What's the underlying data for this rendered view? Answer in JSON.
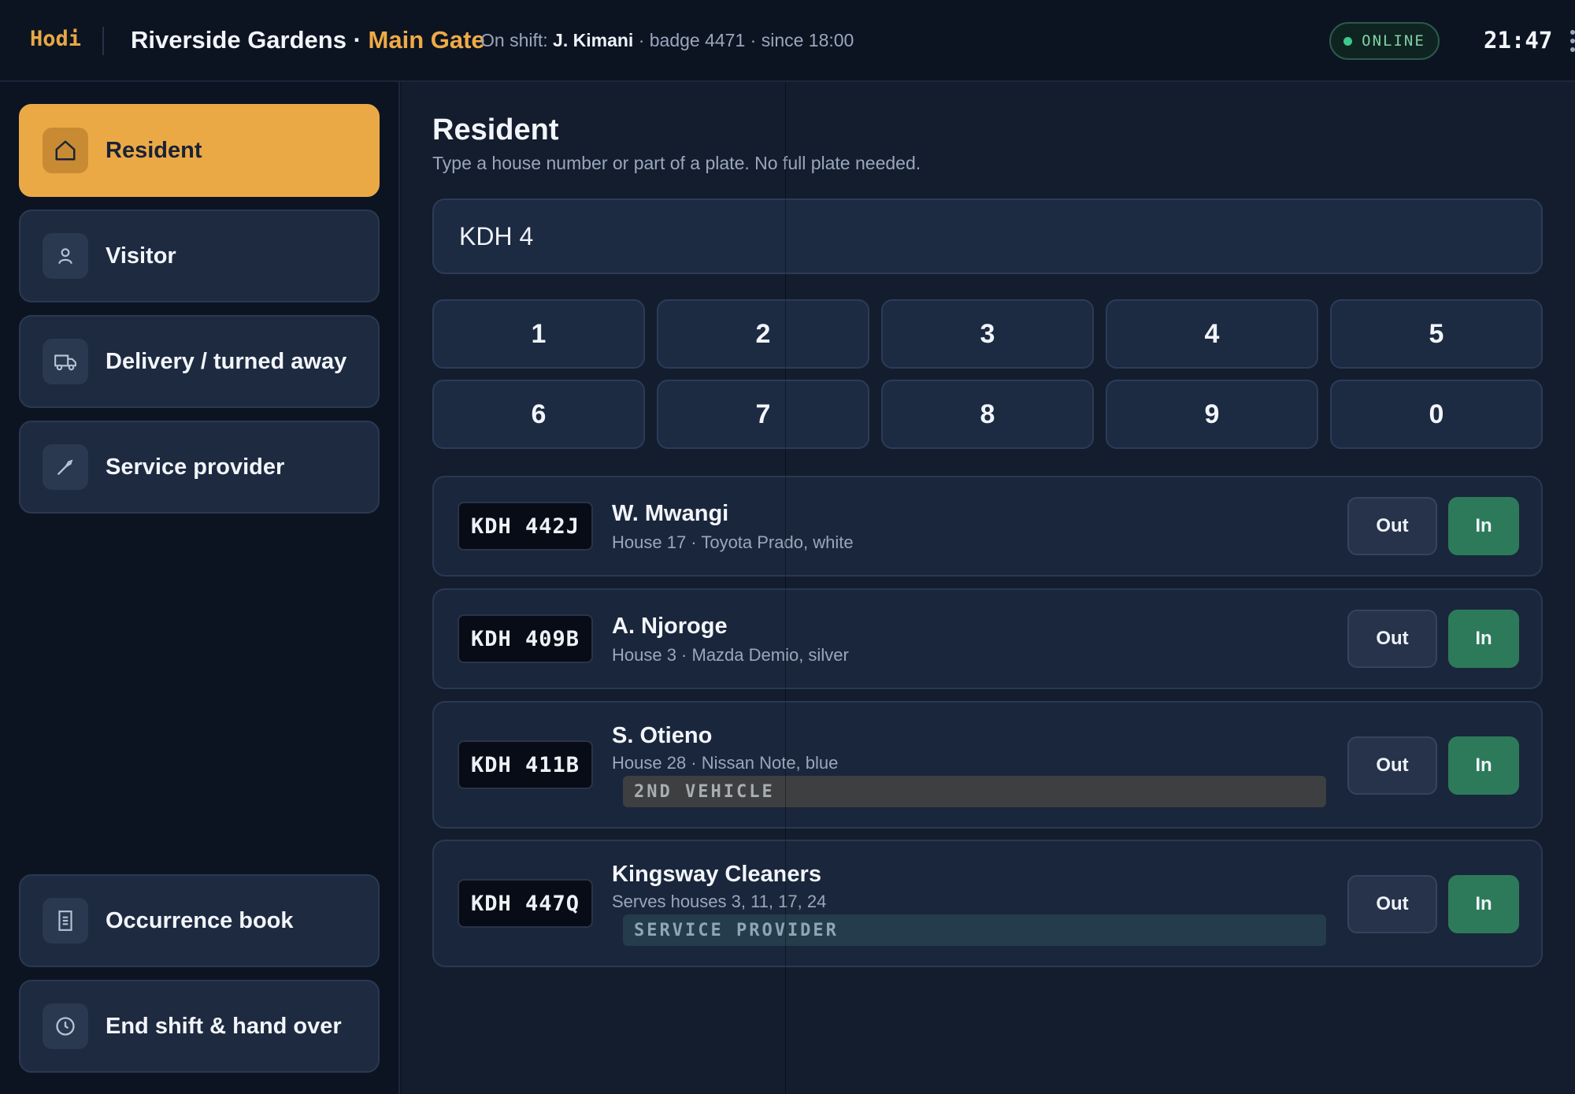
{
  "header": {
    "brand": "Hodi",
    "site_name": "Riverside Gardens",
    "separator": " · ",
    "gate": "Main Gate",
    "shift_prefix": "On shift: ",
    "guard_name": "J. Kimani",
    "shift_suffix": " · badge 4471 · since 18:00",
    "status": "ONLINE",
    "time": "21:47"
  },
  "sidebar": {
    "items": [
      {
        "label": "Resident",
        "icon": "home-icon",
        "active": true
      },
      {
        "label": "Visitor",
        "icon": "person-icon",
        "active": false
      },
      {
        "label": "Delivery / turned away",
        "icon": "truck-icon",
        "active": false
      },
      {
        "label": "Service provider",
        "icon": "wrench-icon",
        "active": false
      }
    ],
    "bottom": [
      {
        "label": "Occurrence book",
        "icon": "document-icon"
      },
      {
        "label": "End shift & hand over",
        "icon": "clock-icon"
      }
    ]
  },
  "main": {
    "title": "Resident",
    "subtitle": "Type a house number or part of a plate. No full plate needed.",
    "search_value": "KDH 4",
    "keypad": [
      "1",
      "2",
      "3",
      "4",
      "5",
      "6",
      "7",
      "8",
      "9",
      "0"
    ],
    "results": [
      {
        "plate": "KDH 442J",
        "name": "W. Mwangi",
        "detail": "House 17 · Toyota Prado, white",
        "tag": null,
        "out_label": "Out",
        "in_label": "In"
      },
      {
        "plate": "KDH 409B",
        "name": "A. Njoroge",
        "detail": "House 3 · Mazda Demio, silver",
        "tag": null,
        "out_label": "Out",
        "in_label": "In"
      },
      {
        "plate": "KDH 411B",
        "name": "S. Otieno",
        "detail": "House 28 · Nissan Note, blue",
        "tag": "2ND VEHICLE",
        "out_label": "Out",
        "in_label": "In"
      },
      {
        "plate": "KDH 447Q",
        "name": "Kingsway Cleaners",
        "detail": "Serves houses 3, 11, 17, 24",
        "tag": "SERVICE PROVIDER",
        "out_label": "Out",
        "in_label": "In"
      }
    ]
  },
  "colors": {
    "accent": "#eba946",
    "in_button": "#2d7a5a",
    "online": "#3cc98a"
  }
}
